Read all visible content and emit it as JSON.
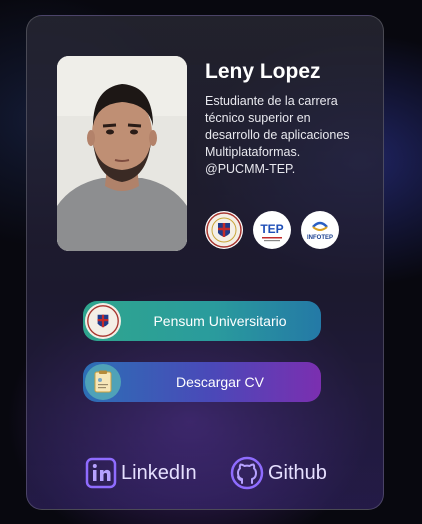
{
  "profile": {
    "name": "Leny Lopez",
    "bio": "Estudiante de la carrera técnico superior en desarrollo de aplicaciones Multiplataformas. @PUCMM-TEP."
  },
  "institution_logos": [
    {
      "icon": "pucmm-seal-icon"
    },
    {
      "icon": "tep-logo-icon",
      "text": "TEP"
    },
    {
      "icon": "infotep-logo-icon",
      "text": "INFOTEP"
    }
  ],
  "buttons": {
    "pensum": {
      "label": "Pensum Universitario",
      "icon": "pucmm-seal-icon"
    },
    "cv": {
      "label": "Descargar CV",
      "icon": "document-icon"
    }
  },
  "social": {
    "linkedin": {
      "label": "LinkedIn",
      "icon": "linkedin-icon"
    },
    "github": {
      "label": "Github",
      "icon": "github-icon"
    }
  },
  "colors": {
    "pensum_gradient": [
      "#2fa58e",
      "#2479a6"
    ],
    "cv_gradient": [
      "#2c6fb5",
      "#7b2fb0"
    ],
    "social_icon": "#9b7bff"
  }
}
